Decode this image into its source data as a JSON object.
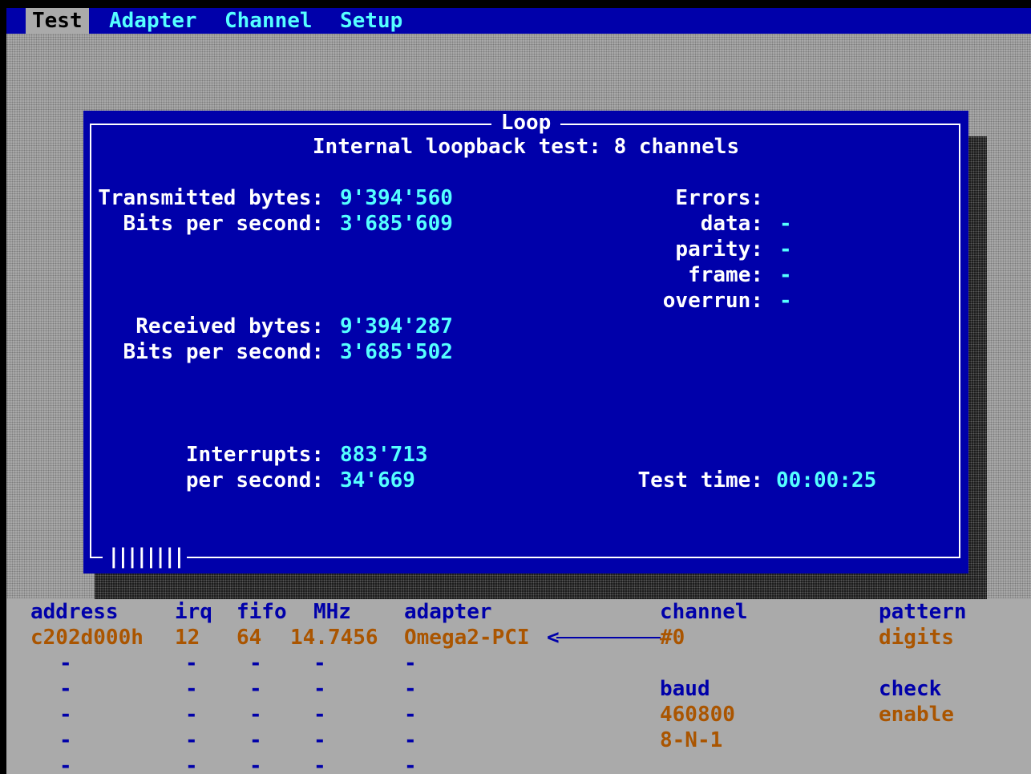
{
  "menu": {
    "items": [
      {
        "label": "Test"
      },
      {
        "label": "Adapter"
      },
      {
        "label": "Channel"
      },
      {
        "label": "Setup"
      }
    ]
  },
  "dialog": {
    "title": "Loop",
    "subtitle": "Internal loopback test: 8 channels",
    "transmitted": {
      "bytes_label": "Transmitted bytes:",
      "bytes": "9'394'560",
      "bps_label": "Bits per second:",
      "bps": "3'685'609"
    },
    "received": {
      "bytes_label": "Received bytes:",
      "bytes": "9'394'287",
      "bps_label": "Bits per second:",
      "bps": "3'685'502"
    },
    "interrupts": {
      "label": "Interrupts:",
      "value": "883'713",
      "rate_label": "per second:",
      "rate": "34'669"
    },
    "errors": {
      "label": "Errors:",
      "data_label": "data:",
      "data": "-",
      "parity_label": "parity:",
      "parity": "-",
      "frame_label": "frame:",
      "frame": "-",
      "overrun_label": "overrun:",
      "overrun": "-"
    },
    "test_time": {
      "label": "Test time:",
      "value": "00:00:25"
    },
    "progress": "||||||||"
  },
  "status": {
    "headers": {
      "address": "address",
      "irq": "irq",
      "fifo": "fifo",
      "mhz": "MHz",
      "adapter": "adapter",
      "channel": "channel",
      "pattern": "pattern"
    },
    "row": {
      "address": "c202d000h",
      "irq": "12",
      "fifo": "64",
      "mhz": "14.7456",
      "adapter": "Omega2-PCI",
      "channel": "#0",
      "pattern": "digits"
    },
    "empty": "-",
    "baud": {
      "label": "baud",
      "value": "460800",
      "format": "8-N-1"
    },
    "check": {
      "label": "check",
      "value": "enable"
    }
  },
  "colors": {
    "background_blue": "#0000aa",
    "value_cyan": "#55ffff",
    "text_white": "#ffffff",
    "highlight_orange": "#aa5500",
    "desk_gray": "#aaaaaa"
  }
}
